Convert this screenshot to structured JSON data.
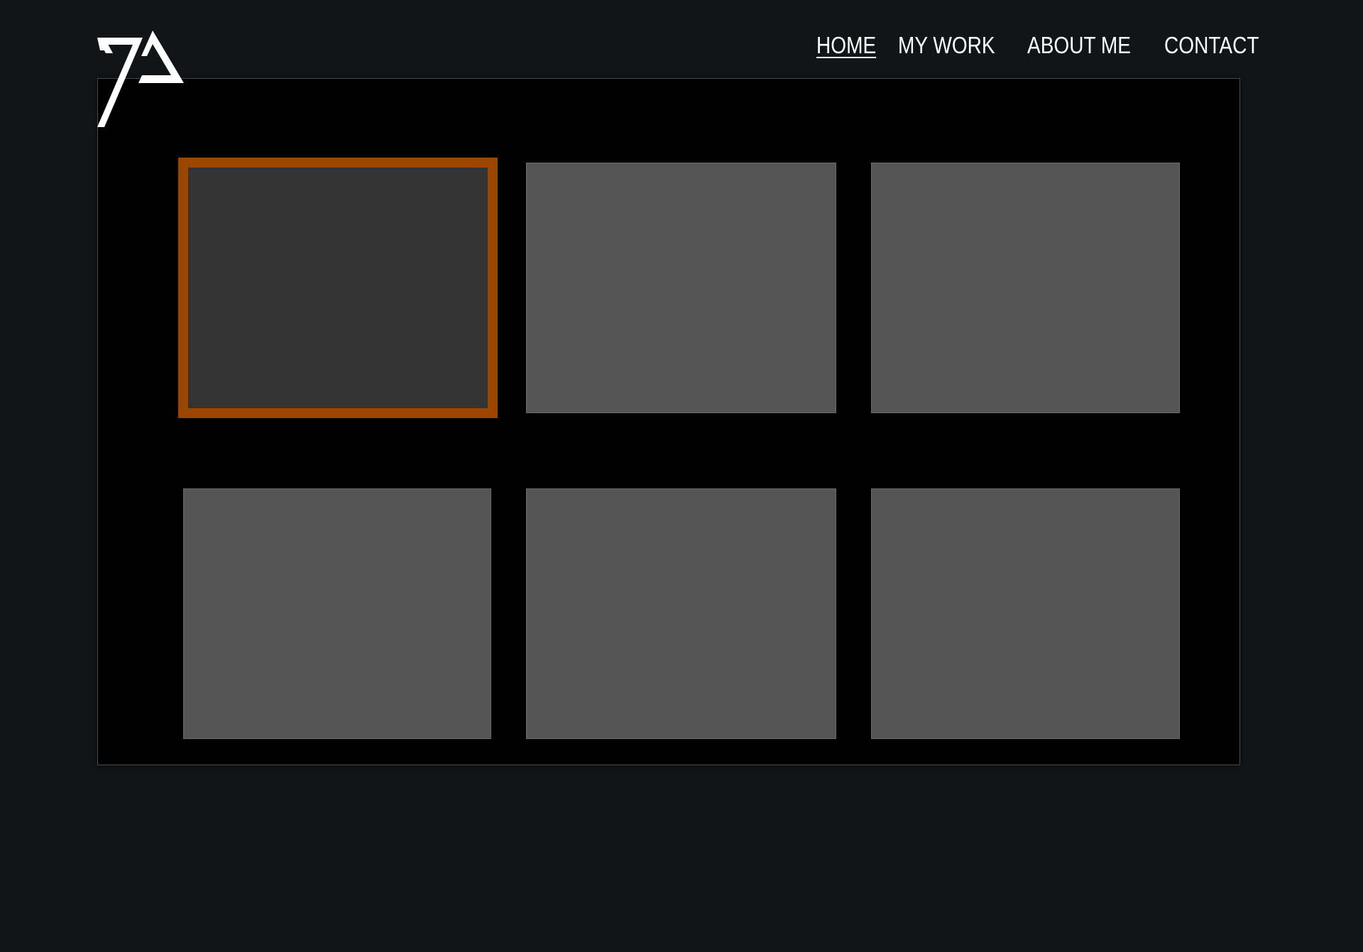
{
  "nav": {
    "items": [
      {
        "label": "HOME",
        "active": true
      },
      {
        "label": "MY WORK",
        "active": false
      },
      {
        "label": "ABOUT ME",
        "active": false
      },
      {
        "label": "CONTACT",
        "active": false
      }
    ]
  },
  "logo": {
    "icon": "ya-monogram-logo"
  },
  "gallery": {
    "tiles": [
      {
        "selected": true
      },
      {
        "selected": false
      },
      {
        "selected": false
      },
      {
        "selected": false
      },
      {
        "selected": false
      },
      {
        "selected": false
      }
    ],
    "colors": {
      "tile": "#555555",
      "selected_fill": "#333333",
      "selected_border": "#9a4500"
    }
  },
  "colors": {
    "page_background": "#111518",
    "panel_background": "#000000",
    "text": "#ffffff"
  }
}
